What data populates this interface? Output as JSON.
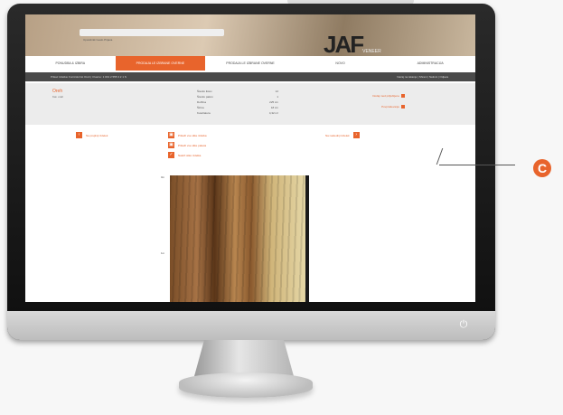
{
  "site": {
    "logo_text": "JAF",
    "logo_sub": "VENEER",
    "login_text": "Uporabnik  Geslo  Prijava",
    "nav": [
      "PONUDBA & IZBIRA",
      "PRODAJA LE IZBRANE OVERNE",
      "PRODAJA LE IZBRANE OVERNE",
      "NOVO",
      "ADMINISTRACIJA"
    ],
    "active_nav_index": 1,
    "bar_left": "Prikaz izdelka: Furnirski list Oreh | Ovarno: 1 001 2 555 3 2 1 S",
    "bar_right": "Nazaj na iskanje | Shrani | Natisni | Odjava"
  },
  "product": {
    "title": "Oreh",
    "subtitle": "Kat. oreh",
    "specs": [
      {
        "label": "Število listov",
        "value": "12"
      },
      {
        "label": "Število pakov",
        "value": "1"
      },
      {
        "label": "Dolžina",
        "value": "225 cm"
      },
      {
        "label": "Širina",
        "value": "18 cm"
      },
      {
        "label": "Kvadratura",
        "value": "4,32 m²"
      }
    ],
    "links": [
      "Dodaj med priljubljene",
      "Povpraševanje"
    ]
  },
  "actions": {
    "prev": "Na prejšnji izdelek",
    "next": "Na naslednji izdelek",
    "gallery1": "Prikaži vse slike izdelka",
    "gallery2": "Prikaži vse slike paketa",
    "download": "Naloži sliko izdelka"
  },
  "ruler_labels": [
    "0m",
    "1m"
  ],
  "callout": "C",
  "colors": {
    "accent": "#e8642c",
    "dark_bar": "#4a4a4a",
    "panel": "#ececec"
  }
}
